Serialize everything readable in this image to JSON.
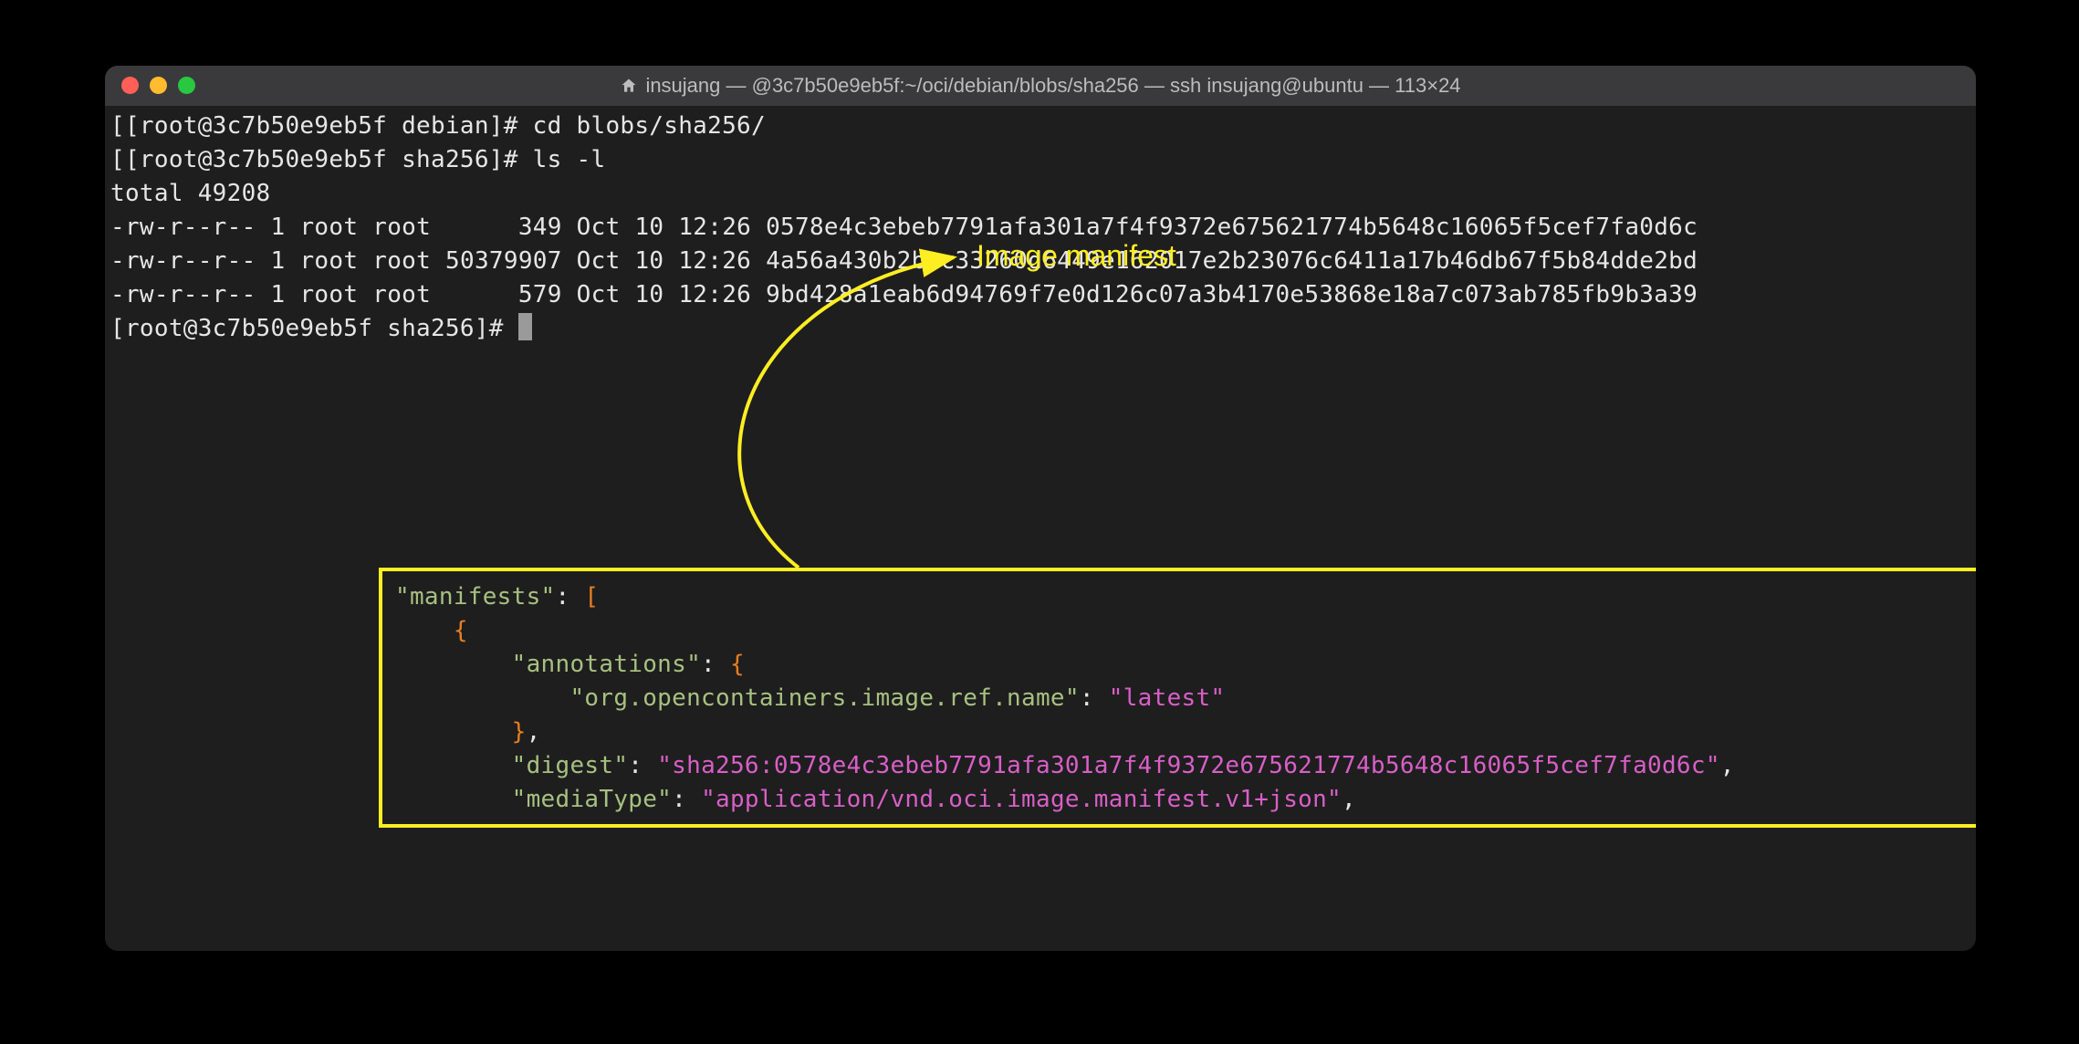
{
  "window": {
    "title": "insujang — @3c7b50e9eb5f:~/oci/debian/blobs/sha256 — ssh insujang@ubuntu — 113×24"
  },
  "terminal": {
    "prompt1_prefix": "[root@3c7b50e9eb5f debian]# ",
    "cmd1": "cd blobs/sha256/",
    "prompt2_prefix": "[root@3c7b50e9eb5f sha256]# ",
    "cmd2": "ls -l",
    "total_line": "total 49208",
    "rows": [
      {
        "perm": "-rw-r--r--",
        "links": "1",
        "owner": "root",
        "group": "root",
        "size_padded": "     349",
        "date": "Oct 10 12:26",
        "name": "0578e4c3ebeb7791afa301a7f4f9372e675621774b5648c16065f5cef7fa0d6c"
      },
      {
        "perm": "-rw-r--r--",
        "links": "1",
        "owner": "root",
        "group": "root",
        "size_padded": "50379907",
        "date": "Oct 10 12:26",
        "name": "4a56a430b2bac33260d6449e162017e2b23076c6411a17b46db67f5b84dde2bd"
      },
      {
        "perm": "-rw-r--r--",
        "links": "1",
        "owner": "root",
        "group": "root",
        "size_padded": "     579",
        "date": "Oct 10 12:26",
        "name": "9bd428a1eab6d94769f7e0d126c07a3b4170e53868e18a7c073ab785fb9b3a39"
      }
    ],
    "prompt3_prefix": "[root@3c7b50e9eb5f sha256]# "
  },
  "annotation": {
    "label": "Image manifest"
  },
  "json_snippet": {
    "key_manifests": "\"manifests\"",
    "open_array": "[",
    "open_brace": "{",
    "key_annotations": "\"annotations\"",
    "open_brace2": "{",
    "key_ref_name": "\"org.opencontainers.image.ref.name\"",
    "val_latest": "\"latest\"",
    "close_brace_ann": "}",
    "key_digest": "\"digest\"",
    "val_digest": "\"sha256:0578e4c3ebeb7791afa301a7f4f9372e675621774b5648c16065f5cef7fa0d6c\"",
    "key_mediaType": "\"mediaType\"",
    "val_mediaType": "\"application/vnd.oci.image.manifest.v1+json\""
  }
}
